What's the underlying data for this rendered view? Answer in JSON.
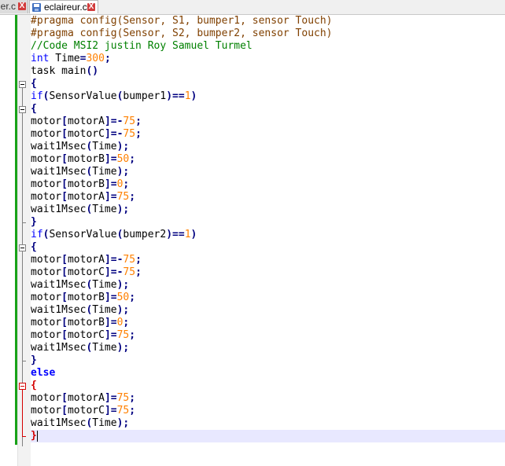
{
  "tabs": [
    {
      "label": "er.c",
      "active": false
    },
    {
      "label": "eclaireur.c",
      "active": true
    }
  ],
  "close_glyph": "X",
  "code": [
    "#pragma config(Sensor, S1, bumper1, sensor Touch)",
    "#pragma config(Sensor, S2, bumper2, sensor Touch)",
    "//Code MSI2 justin Roy Samuel Turmel",
    "int Time=300;",
    "task main()",
    "{",
    "if(SensorValue(bumper1)==1)",
    "{",
    "motor[motorA]=-75;",
    "motor[motorC]=-75;",
    "wait1Msec(Time);",
    "motor[motorB]=50;",
    "wait1Msec(Time);",
    "motor[motorB]=0;",
    "motor[motorA]=75;",
    "wait1Msec(Time);",
    "}",
    "if(SensorValue(bumper2)==1)",
    "{",
    "motor[motorA]=-75;",
    "motor[motorC]=-75;",
    "wait1Msec(Time);",
    "motor[motorB]=50;",
    "wait1Msec(Time);",
    "motor[motorB]=0;",
    "motor[motorC]=75;",
    "wait1Msec(Time);",
    "}",
    "else",
    "{",
    "motor[motorA]=75;",
    "motor[motorC]=75;",
    "wait1Msec(Time);",
    "}"
  ],
  "colors": {
    "preprocessor": "#804000",
    "comment": "#008000",
    "keyword": "#0000ff",
    "number": "#ff8000",
    "operator": "#000080",
    "change_bar": "#18a218",
    "current_line": "#e8e8ff"
  }
}
